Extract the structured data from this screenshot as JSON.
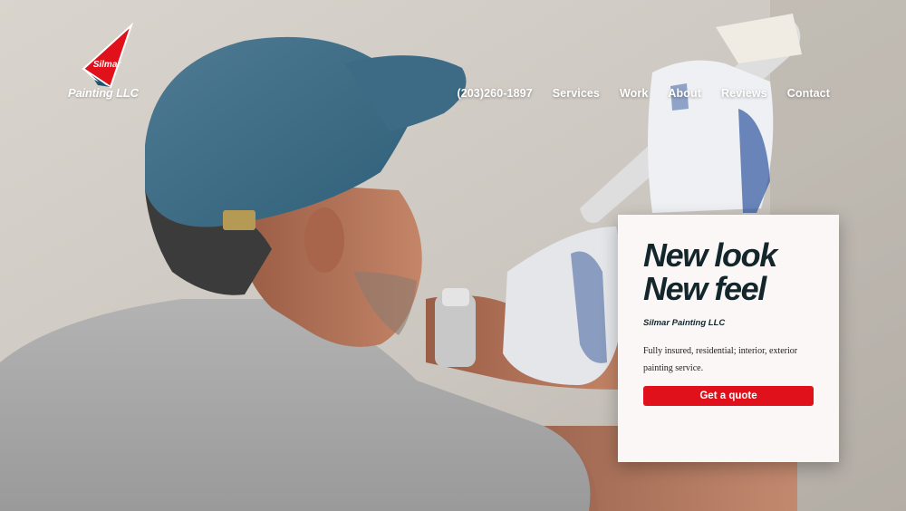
{
  "brand": {
    "logo_text": "Silmar",
    "name": "Painting LLC",
    "colors": {
      "red": "#e0111a",
      "navy": "#1d5270"
    }
  },
  "nav": {
    "phone": "(203)260-1897",
    "items": [
      "Services",
      "Work",
      "About",
      "Reviews",
      "Contact"
    ]
  },
  "hero": {
    "background": "painter-photo"
  },
  "card": {
    "headline_line1": "New look",
    "headline_line2": "New feel",
    "subtitle": "Silmar Painting LLC",
    "description": "Fully insured, residential; interior, exterior painting service.",
    "cta_label": "Get a quote"
  }
}
